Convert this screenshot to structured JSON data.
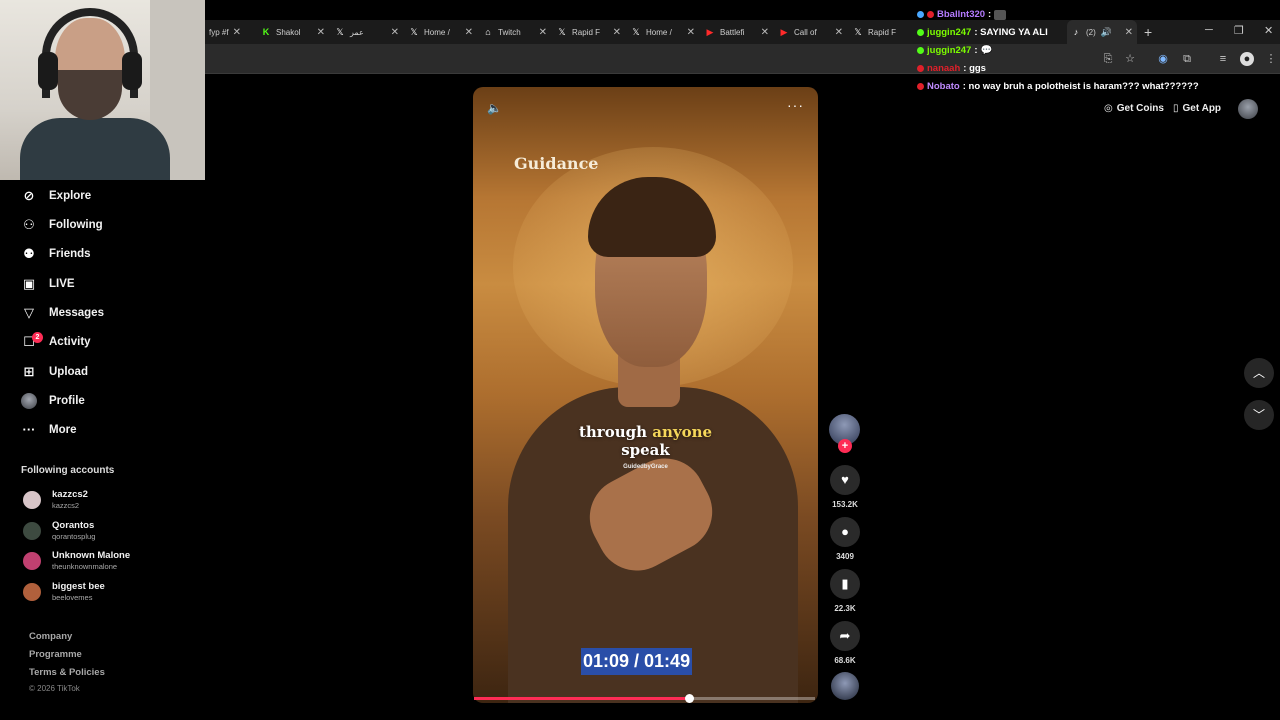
{
  "browser": {
    "tabs": [
      {
        "title": "fyp #f",
        "icon": "",
        "active": false
      },
      {
        "title": "Shakol",
        "icon": "K",
        "active": false
      },
      {
        "title": "عمر",
        "icon": "𝕏",
        "active": false
      },
      {
        "title": "Home /",
        "icon": "𝕏",
        "active": false
      },
      {
        "title": "Twitch",
        "icon": "⌂",
        "active": false
      },
      {
        "title": "Rapid F",
        "icon": "𝕏",
        "active": false
      },
      {
        "title": "Home /",
        "icon": "𝕏",
        "active": false
      },
      {
        "title": "Battlefi",
        "icon": "▶",
        "active": false
      },
      {
        "title": "Call of",
        "icon": "▶",
        "active": false
      },
      {
        "title": "Rapid F",
        "icon": "𝕏",
        "active": false
      },
      {
        "title": "(2)",
        "icon": "♪",
        "active": true
      }
    ]
  },
  "chat": [
    {
      "user": "Bballnt320",
      "text": ":",
      "color": "#b57bff"
    },
    {
      "user": "juggin247",
      "text": ": SAYING YA ALI",
      "color": "#7cfc00"
    },
    {
      "user": "juggin247",
      "text": ":",
      "color": "#7cfc00"
    },
    {
      "user": "nanaah",
      "text": ": ggs",
      "color": "#e0202a"
    },
    {
      "user": "Nobato",
      "text": ": no way bruh a polotheist is haram??? what??????",
      "color": "#c08bff"
    }
  ],
  "header": {
    "get_coins": "Get Coins",
    "get_app": "Get App"
  },
  "sidebar": {
    "nav": [
      {
        "label": "Explore",
        "icon": "compass-icon"
      },
      {
        "label": "Following",
        "icon": "following-icon"
      },
      {
        "label": "Friends",
        "icon": "friends-icon"
      },
      {
        "label": "LIVE",
        "icon": "live-icon"
      },
      {
        "label": "Messages",
        "icon": "messages-icon"
      },
      {
        "label": "Activity",
        "icon": "activity-icon"
      },
      {
        "label": "Upload",
        "icon": "upload-icon"
      },
      {
        "label": "Profile",
        "icon": "profile-avatar"
      },
      {
        "label": "More",
        "icon": "more-icon"
      }
    ],
    "activity_badge": "2",
    "following_heading": "Following accounts",
    "accounts": [
      {
        "name": "kazzcs2",
        "handle": "kazzcs2",
        "color": "#d8c5c8"
      },
      {
        "name": "Qorantos",
        "handle": "qorantosplug",
        "color": "#3d4a40"
      },
      {
        "name": "Unknown Malone",
        "handle": "theunknownmalone",
        "color": "#c04070"
      },
      {
        "name": "biggest bee",
        "handle": "beelovemes",
        "color": "#b0603c"
      }
    ],
    "footer": {
      "company": "Company",
      "programme": "Programme",
      "terms": "Terms & Policies",
      "copyright": "© 2026 TikTok"
    }
  },
  "video": {
    "title": "Guidance",
    "caption_plain": "through",
    "caption_highlight": "anyone",
    "caption_line2": "speak",
    "watermark": "GuidedbyGrace",
    "time": "01:09 / 01:49",
    "progress": 0.63
  },
  "actions": {
    "likes": "153.2K",
    "comments": "3409",
    "saves": "22.3K",
    "shares": "68.6K"
  },
  "colors": {
    "accent": "#fe2c55",
    "time_highlight": "#2a4ea8",
    "caption_highlight": "#f5d75a"
  }
}
